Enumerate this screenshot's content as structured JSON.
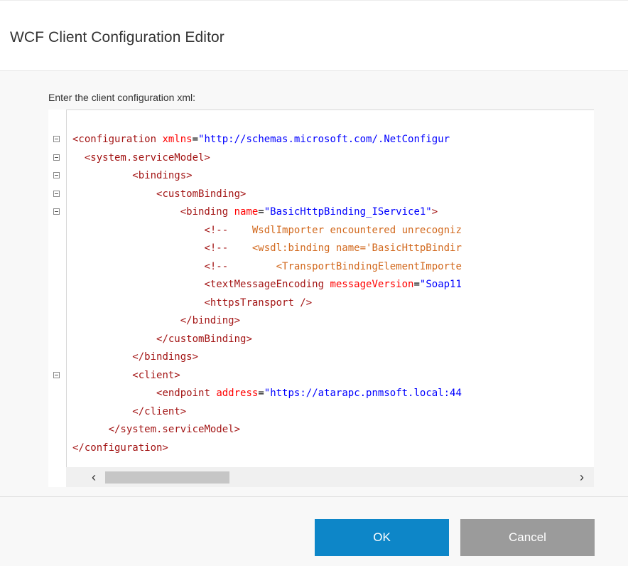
{
  "dialog": {
    "title": "WCF Client Configuration Editor",
    "prompt": "Enter the client configuration xml:"
  },
  "editor": {
    "lines": [
      {
        "indent": "",
        "foldable": true,
        "segments": [
          {
            "t": "tag",
            "v": "<configuration "
          },
          {
            "t": "attr",
            "v": "xmlns"
          },
          {
            "t": "plain",
            "v": "="
          },
          {
            "t": "val",
            "v": "\"http://schemas.microsoft.com/.NetConfigur"
          }
        ]
      },
      {
        "indent": "  ",
        "foldable": true,
        "segments": [
          {
            "t": "tag",
            "v": "<system.serviceModel>"
          }
        ]
      },
      {
        "indent": "          ",
        "foldable": true,
        "segments": [
          {
            "t": "tag",
            "v": "<bindings>"
          }
        ]
      },
      {
        "indent": "              ",
        "foldable": true,
        "segments": [
          {
            "t": "tag",
            "v": "<customBinding>"
          }
        ]
      },
      {
        "indent": "                  ",
        "foldable": true,
        "segments": [
          {
            "t": "tag",
            "v": "<binding "
          },
          {
            "t": "attr",
            "v": "name"
          },
          {
            "t": "plain",
            "v": "="
          },
          {
            "t": "val",
            "v": "\"BasicHttpBinding_IService1\""
          },
          {
            "t": "tag",
            "v": ">"
          }
        ]
      },
      {
        "indent": "                      ",
        "foldable": false,
        "segments": [
          {
            "t": "tag",
            "v": "<!--"
          },
          {
            "t": "cmt",
            "v": "    WsdlImporter encountered unrecogniz"
          }
        ]
      },
      {
        "indent": "                      ",
        "foldable": false,
        "segments": [
          {
            "t": "tag",
            "v": "<!--"
          },
          {
            "t": "cmt",
            "v": "    <wsdl:binding name='BasicHttpBindir"
          }
        ]
      },
      {
        "indent": "                      ",
        "foldable": false,
        "segments": [
          {
            "t": "tag",
            "v": "<!--"
          },
          {
            "t": "cmt",
            "v": "        <TransportBindingElementImporte"
          }
        ]
      },
      {
        "indent": "                      ",
        "foldable": false,
        "segments": [
          {
            "t": "tag",
            "v": "<textMessageEncoding "
          },
          {
            "t": "attr",
            "v": "messageVersion"
          },
          {
            "t": "plain",
            "v": "="
          },
          {
            "t": "val",
            "v": "\"Soap11"
          }
        ]
      },
      {
        "indent": "                      ",
        "foldable": false,
        "segments": [
          {
            "t": "tag",
            "v": "<httpsTransport />"
          }
        ]
      },
      {
        "indent": "                  ",
        "foldable": false,
        "segments": [
          {
            "t": "tag",
            "v": "</binding>"
          }
        ]
      },
      {
        "indent": "              ",
        "foldable": false,
        "segments": [
          {
            "t": "tag",
            "v": "</customBinding>"
          }
        ]
      },
      {
        "indent": "          ",
        "foldable": false,
        "segments": [
          {
            "t": "tag",
            "v": "</bindings>"
          }
        ]
      },
      {
        "indent": "          ",
        "foldable": true,
        "segments": [
          {
            "t": "tag",
            "v": "<client>"
          }
        ]
      },
      {
        "indent": "              ",
        "foldable": false,
        "segments": [
          {
            "t": "tag",
            "v": "<endpoint "
          },
          {
            "t": "attr",
            "v": "address"
          },
          {
            "t": "plain",
            "v": "="
          },
          {
            "t": "val",
            "v": "\"https://atarapc.pnmsoft.local:44"
          }
        ]
      },
      {
        "indent": "          ",
        "foldable": false,
        "segments": [
          {
            "t": "tag",
            "v": "</client>"
          }
        ]
      },
      {
        "indent": "      ",
        "foldable": false,
        "segments": [
          {
            "t": "tag",
            "v": "</system.serviceModel>"
          }
        ]
      },
      {
        "indent": "",
        "foldable": false,
        "segments": [
          {
            "t": "tag",
            "v": "</configuration>"
          }
        ]
      }
    ],
    "scroll_left_icon": "‹",
    "scroll_right_icon": "›"
  },
  "buttons": {
    "ok": "OK",
    "cancel": "Cancel"
  },
  "colors": {
    "tag": "#a31515",
    "attribute": "#ff0000",
    "value": "#0000ff",
    "comment": "#d2691e",
    "ok_button": "#0d86c8",
    "cancel_button": "#9b9b9b"
  }
}
